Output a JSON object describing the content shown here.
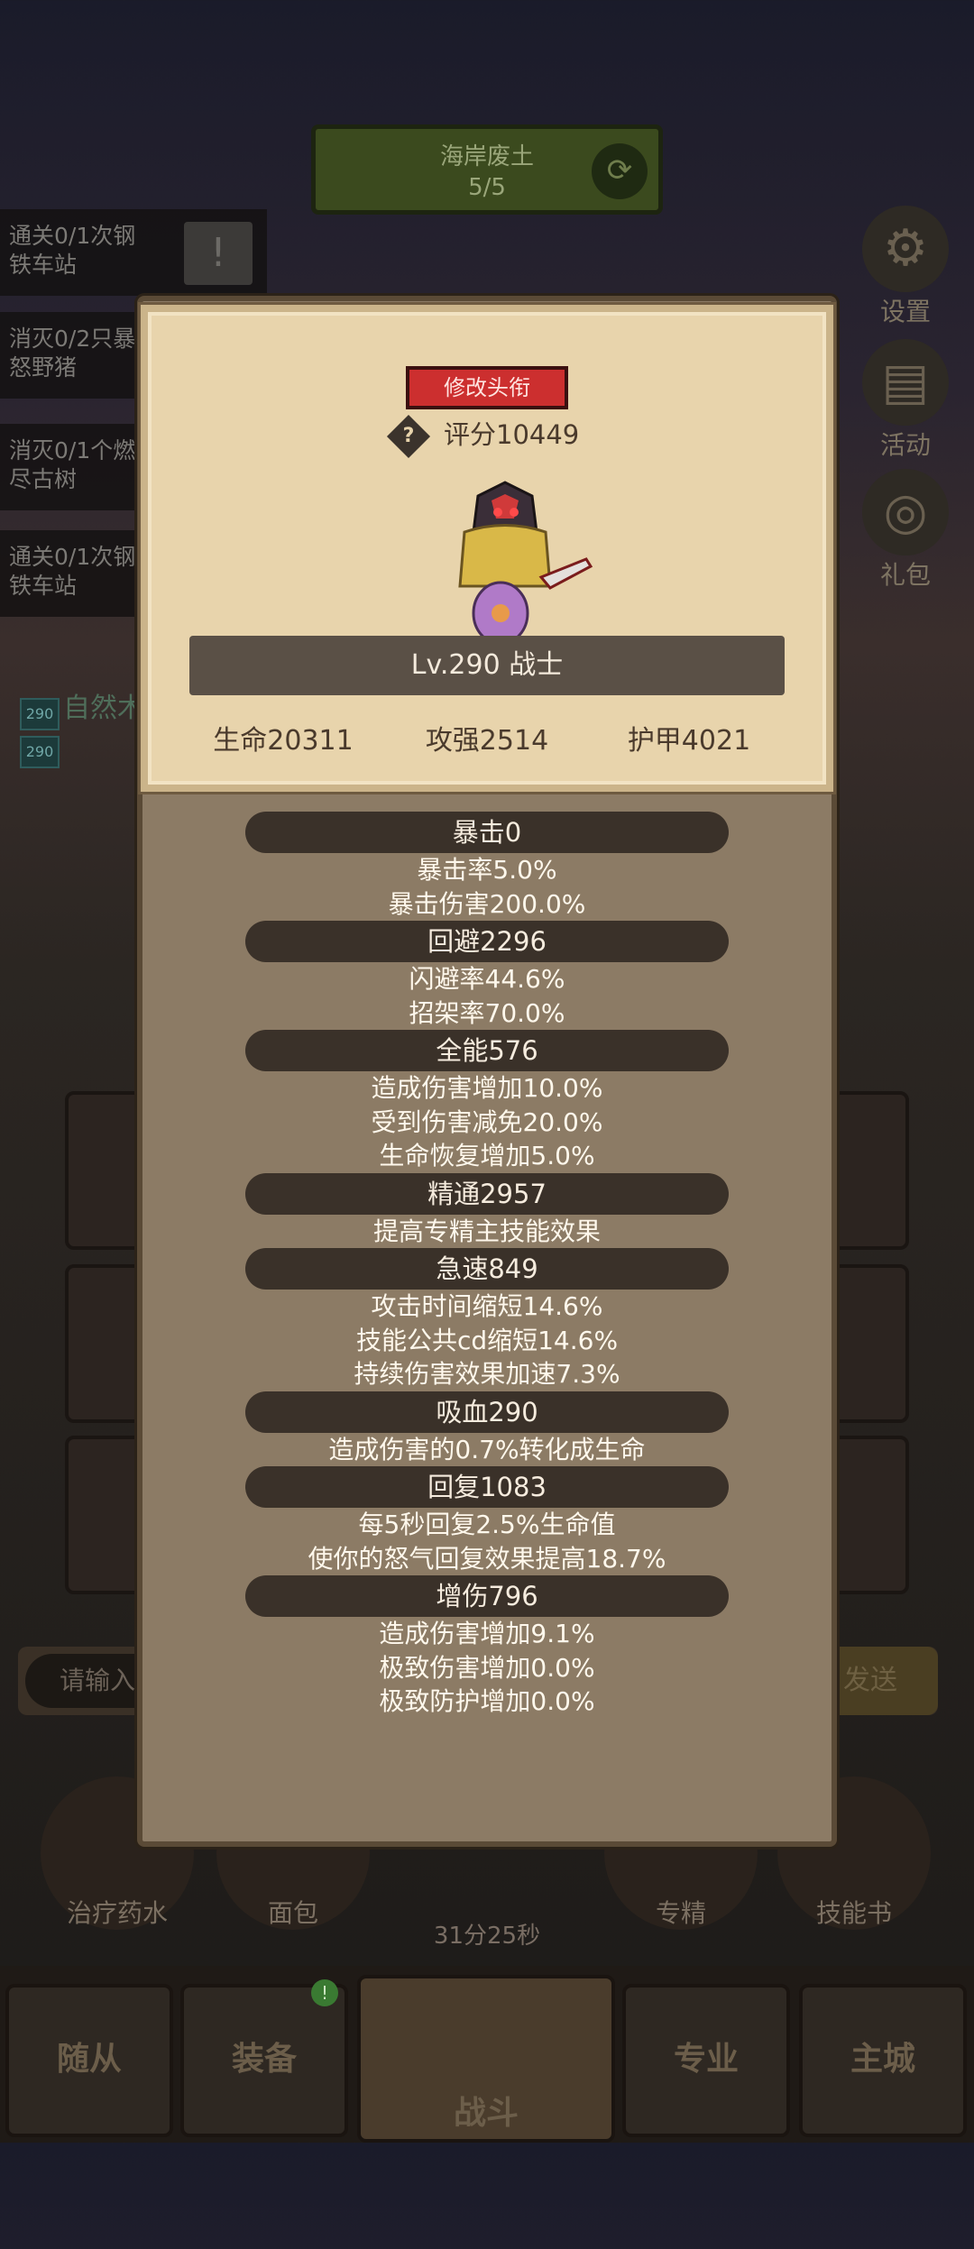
{
  "background": {
    "stage": {
      "name": "海岸废土",
      "progress": "5/5"
    },
    "quests": [
      {
        "text_line1": "通关0/1次钢",
        "text_line2": "铁车站"
      },
      {
        "text_line1": "消灭0/2只暴",
        "text_line2": "怒野猪"
      },
      {
        "text_line1": "消灭0/1个燃",
        "text_line2": "尽古树"
      },
      {
        "text_line1": "通关0/1次钢",
        "text_line2": "铁车站"
      }
    ],
    "side_buttons": {
      "settings": "设置",
      "events": "活动",
      "gift": "礼包"
    },
    "level_tags": [
      "290",
      "290"
    ],
    "partial_label": "自然木",
    "chat": {
      "placeholder": "请输入",
      "send": "发送"
    },
    "items": [
      "治疗药水",
      "面包",
      "专精",
      "技能书"
    ],
    "timer": "31分25秒",
    "nav": {
      "followers": "随从",
      "equipment": "装备",
      "battle": "战斗",
      "profession": "专业",
      "city": "主城"
    },
    "nav_badge": "!"
  },
  "profile": {
    "edit_title_button": "修改头衔",
    "score": "评分10449",
    "help_icon": "?",
    "level_class": "Lv.290 战士",
    "basic_stats": {
      "hp": "生命20311",
      "attack": "攻强2514",
      "armor": "护甲4021"
    }
  },
  "stats": [
    {
      "name": "暴击0",
      "details": [
        "暴击率5.0%",
        "暴击伤害200.0%"
      ]
    },
    {
      "name": "回避2296",
      "details": [
        "闪避率44.6%",
        "招架率70.0%"
      ]
    },
    {
      "name": "全能576",
      "details": [
        "造成伤害增加10.0%",
        "受到伤害减免20.0%",
        "生命恢复增加5.0%"
      ]
    },
    {
      "name": "精通2957",
      "details": [
        "提高专精主技能效果"
      ]
    },
    {
      "name": "急速849",
      "details": [
        "攻击时间缩短14.6%",
        "技能公共cd缩短14.6%",
        "持续伤害效果加速7.3%"
      ]
    },
    {
      "name": "吸血290",
      "details": [
        "造成伤害的0.7%转化成生命"
      ]
    },
    {
      "name": "回复1083",
      "details": [
        "每5秒回复2.5%生命值",
        "使你的怒气回复效果提高18.7%"
      ]
    },
    {
      "name": "增伤796",
      "details": [
        "造成伤害增加9.1%",
        "极致伤害增加0.0%",
        "极致防护增加0.0%"
      ]
    }
  ]
}
